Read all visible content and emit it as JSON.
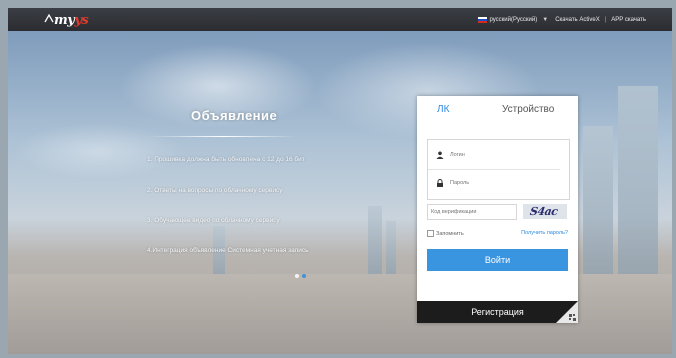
{
  "header": {
    "logo_text_a": "my",
    "logo_text_b": "y",
    "logo_text_c": "s",
    "language": "русский(Русский)",
    "activex_link": "Скачать ActiveX",
    "separator": "|",
    "app_link": "APP скачать"
  },
  "announcement": {
    "title": "Объявление",
    "items": [
      "1. Прошивка должна быть обновлена с 12 до 16 бит",
      "2. Ответы на вопросы по облачному сервису",
      "3. Обучающее видео по облачному сервису",
      "4.Интеграция объявление Системная учетная запись"
    ]
  },
  "login": {
    "tab_lk": "ЛК",
    "tab_device": "Устройство",
    "login_placeholder": "Логин",
    "password_placeholder": "Пароль",
    "captcha_placeholder": "Код верификации",
    "captcha_text": "S4ac",
    "remember_label": "Запомнить",
    "get_password": "Получить пароль?",
    "login_button": "Войти",
    "register_button": "Регистрация"
  },
  "colors": {
    "accent": "#3a95e0",
    "topbar": "#2a2c31",
    "register": "#1c1c1c"
  }
}
